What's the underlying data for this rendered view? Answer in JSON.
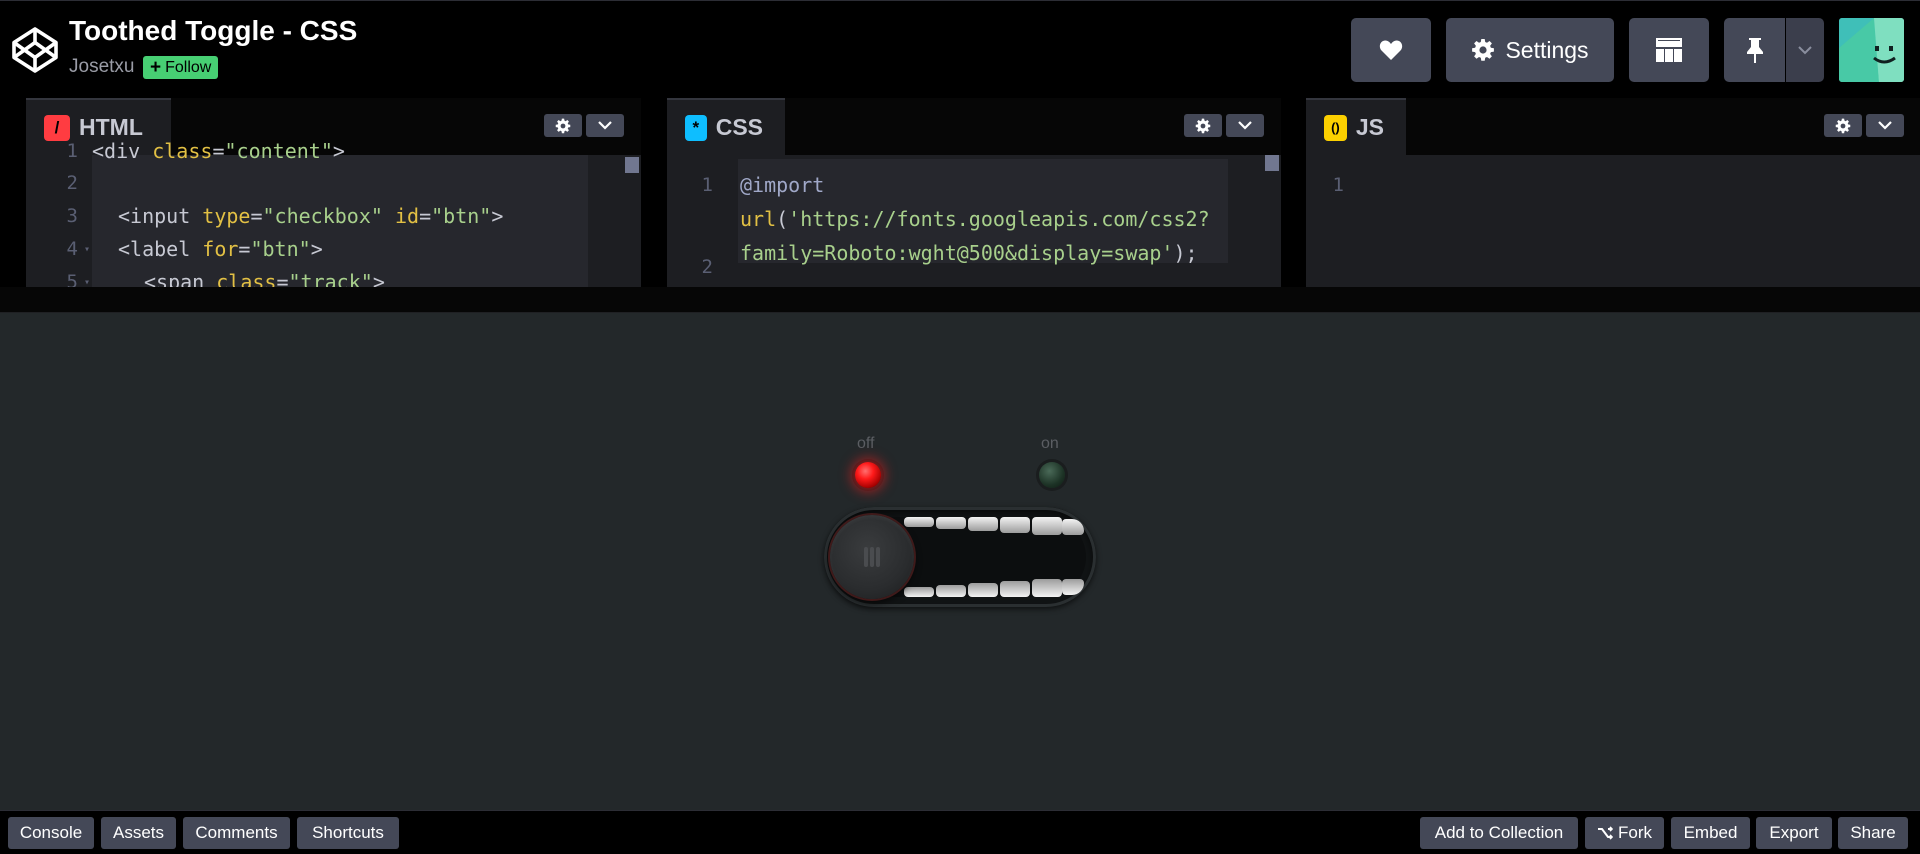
{
  "header": {
    "title": "Toothed Toggle - CSS",
    "author": "Josetxu",
    "follow_label": "Follow",
    "settings_label": "Settings"
  },
  "editors": {
    "html": {
      "name": "HTML",
      "badge": "/",
      "badge_color": "#ff3c41",
      "lines": [
        {
          "n": "1",
          "fold": ""
        },
        {
          "n": "2",
          "fold": ""
        },
        {
          "n": "3",
          "fold": ""
        },
        {
          "n": "4",
          "fold": "▾"
        },
        {
          "n": "5",
          "fold": "▾"
        }
      ],
      "code": {
        "line1_a": "<div ",
        "line1_b": "class",
        "line1_c": "=",
        "line1_d": "\"content\"",
        "line1_e": ">",
        "line3_a": "<input ",
        "line3_b": "type",
        "line3_c": "=",
        "line3_d": "\"checkbox\"",
        "line3_e": " ",
        "line3_f": "id",
        "line3_g": "=",
        "line3_h": "\"btn\"",
        "line3_i": ">",
        "line4_a": "<label ",
        "line4_b": "for",
        "line4_c": "=",
        "line4_d": "\"btn\"",
        "line4_e": ">",
        "line5_a": "<span ",
        "line5_b": "class",
        "line5_c": "=",
        "line5_d": "\"track\"",
        "line5_e": ">"
      }
    },
    "css": {
      "name": "CSS",
      "badge": "*",
      "badge_color": "#0ebeff",
      "lines": [
        {
          "n": "1"
        },
        {
          "n": "2"
        }
      ],
      "code": {
        "line1_a": "@import",
        "line1_b": "url",
        "line1_c": "(",
        "line1_d": "'https://fonts.googleapis.com/css2?",
        "line1_e": "family=Roboto:wght@500&display=swap'",
        "line1_f": ");"
      }
    },
    "js": {
      "name": "JS",
      "badge": "()",
      "badge_color": "#fcd000",
      "lines": [
        {
          "n": "1"
        }
      ]
    }
  },
  "preview": {
    "off_label": "off",
    "on_label": "on",
    "toggle_checked": false
  },
  "footer": {
    "left": [
      "Console",
      "Assets",
      "Comments",
      "Shortcuts"
    ],
    "right": {
      "add_to_collection": "Add to Collection",
      "fork": "Fork",
      "embed": "Embed",
      "export": "Export",
      "share": "Share"
    }
  },
  "colors": {
    "follow_green": "#47cf73",
    "button_gray": "#444857",
    "preview_bg": "#23282a",
    "led_off_red": "#ff1a1a",
    "led_on_green_dim": "#1d3326"
  },
  "icons": {
    "logo": "codepen-logo-icon",
    "heart": "heart-icon",
    "settings": "gear-icon",
    "layout": "layout-icon",
    "pin": "pin-icon",
    "dropdown": "chevron-down-icon",
    "fork": "fork-icon"
  }
}
